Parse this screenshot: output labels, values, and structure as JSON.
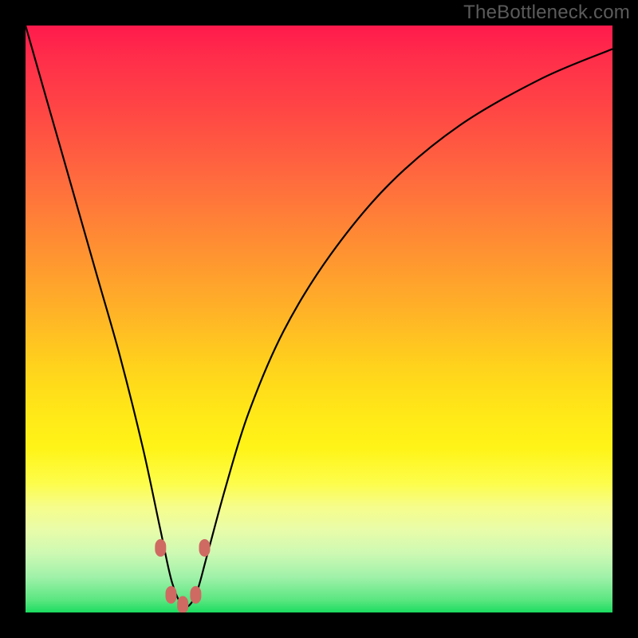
{
  "watermark": "TheBottleneck.com",
  "chart_data": {
    "type": "line",
    "title": "",
    "xlabel": "",
    "ylabel": "",
    "x_range": [
      0,
      100
    ],
    "y_range": [
      0,
      100
    ],
    "note": "Values estimated from pixels; y is mismatch percentage (0 at bottom, 100 at top). Curve minimum near x≈27.",
    "series": [
      {
        "name": "bottleneck-curve",
        "x": [
          0,
          4,
          8,
          12,
          16,
          20,
          23,
          25,
          27,
          29,
          31,
          34,
          38,
          44,
          52,
          62,
          74,
          88,
          100
        ],
        "y": [
          100,
          86,
          72,
          58,
          44,
          28,
          14,
          5,
          1,
          3,
          10,
          21,
          34,
          48,
          61,
          73,
          83,
          91,
          96
        ]
      }
    ],
    "markers": {
      "name": "highlight-beads",
      "points": [
        {
          "x": 23.0,
          "y": 11.0
        },
        {
          "x": 30.5,
          "y": 11.0
        },
        {
          "x": 24.8,
          "y": 3.0
        },
        {
          "x": 29.0,
          "y": 3.0
        },
        {
          "x": 26.8,
          "y": 1.3
        }
      ]
    },
    "background_gradient": {
      "top": "#ff1a4c",
      "mid": "#ffd21c",
      "bottom": "#1bdc60"
    }
  }
}
